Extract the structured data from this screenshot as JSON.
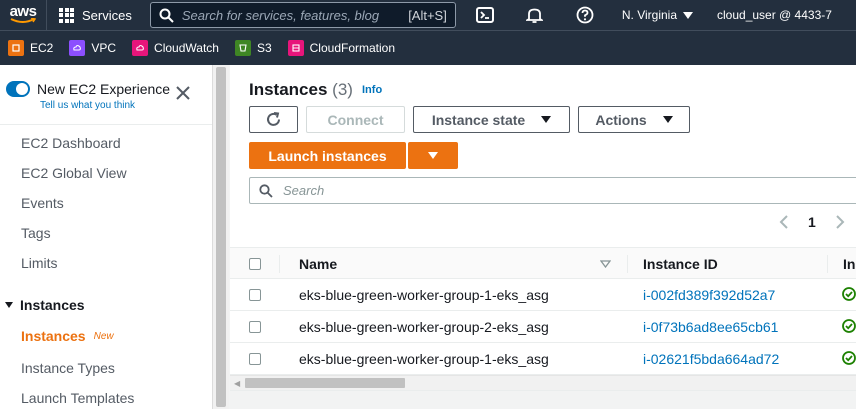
{
  "topnav": {
    "logo_text": "aws",
    "services_label": "Services",
    "search_placeholder": "Search for services, features, blog",
    "search_shortcut": "[Alt+S]",
    "region": "N. Virginia",
    "user": "cloud_user @ 4433-7"
  },
  "favorites": [
    {
      "label": "EC2",
      "color": "#ec7211"
    },
    {
      "label": "VPC",
      "color": "#8c4fff"
    },
    {
      "label": "CloudWatch",
      "color": "#e7157b"
    },
    {
      "label": "S3",
      "color": "#3f8624"
    },
    {
      "label": "CloudFormation",
      "color": "#e7157b"
    }
  ],
  "sidebar": {
    "new_experience_label": "New EC2 Experience",
    "tell_us_label": "Tell us what you think",
    "items": [
      "EC2 Dashboard",
      "EC2 Global View",
      "Events",
      "Tags",
      "Limits"
    ],
    "section_label": "Instances",
    "sub_items": [
      "Instances",
      "Instance Types",
      "Launch Templates"
    ],
    "new_badge": "New"
  },
  "main": {
    "title": "Instances",
    "count": "(3)",
    "info_label": "Info",
    "connect_label": "Connect",
    "instance_state_label": "Instance state",
    "actions_label": "Actions",
    "launch_label": "Launch instances",
    "search_placeholder": "Search",
    "page_number": "1",
    "columns": [
      "Name",
      "Instance ID",
      "In"
    ],
    "rows": [
      {
        "name": "eks-blue-green-worker-group-1-eks_asg",
        "id": "i-002fd389f392d52a7"
      },
      {
        "name": "eks-blue-green-worker-group-2-eks_asg",
        "id": "i-0f73b6ad8ee65cb61"
      },
      {
        "name": "eks-blue-green-worker-group-1-eks_asg",
        "id": "i-02621f5bda664ad72"
      }
    ]
  },
  "colors": {
    "nav_bg": "#232f3e",
    "accent_orange": "#ec7211",
    "link_blue": "#0073bb",
    "status_green": "#1d8102"
  }
}
